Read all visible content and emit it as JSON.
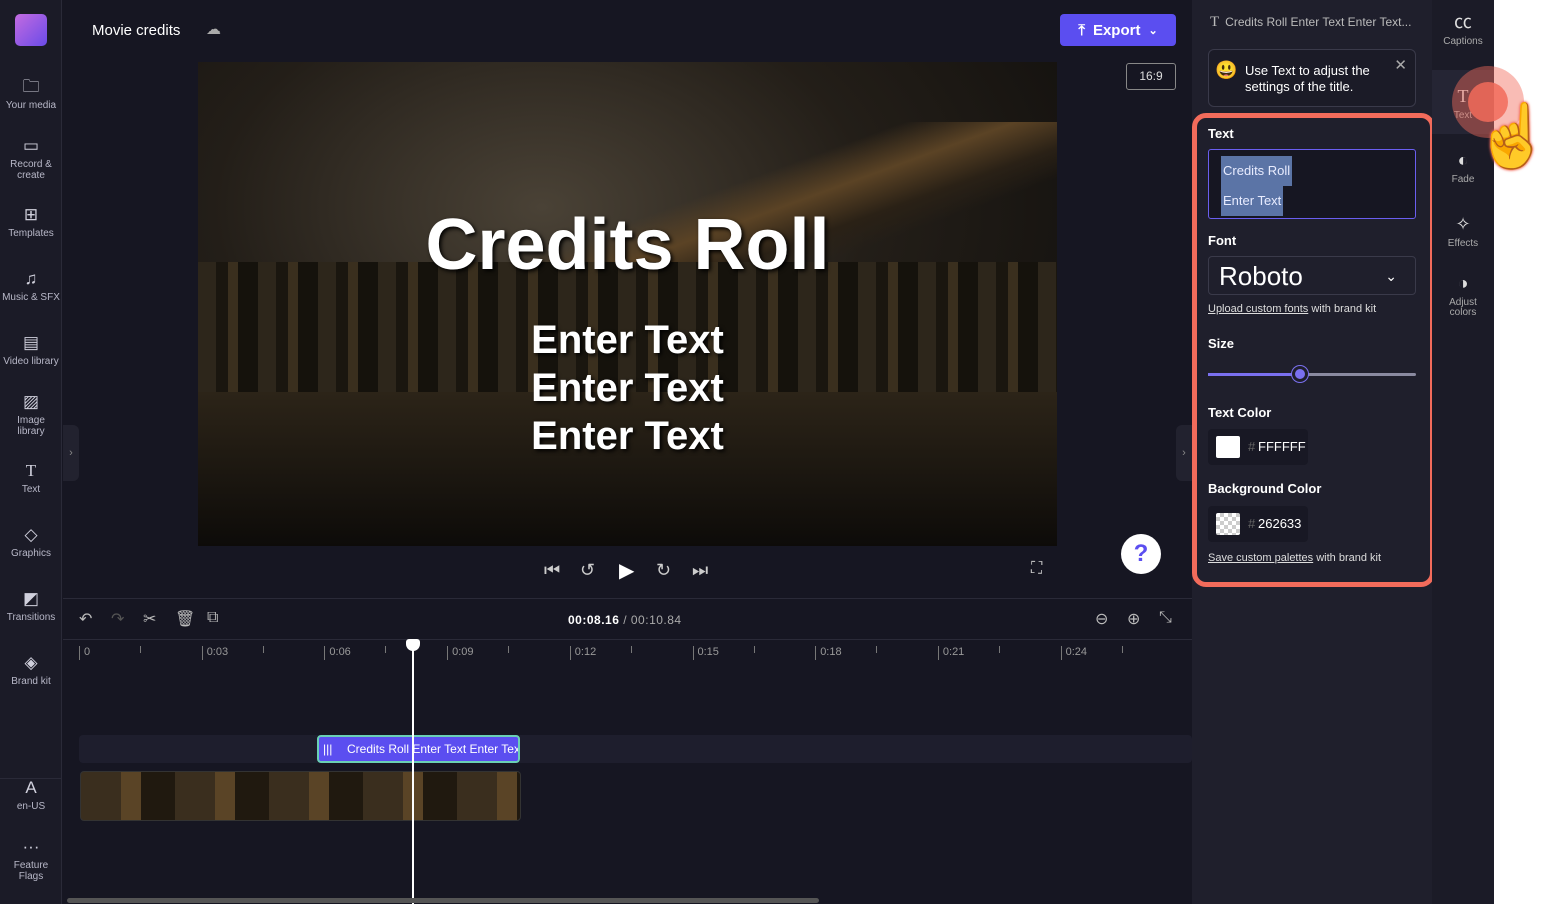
{
  "header": {
    "project_title": "Movie credits",
    "export_label": "Export",
    "aspect_ratio": "16:9"
  },
  "sidebar": {
    "items": [
      {
        "label": "Your media",
        "icon": "folder-icon"
      },
      {
        "label": "Record & create",
        "icon": "video-camera-icon"
      },
      {
        "label": "Templates",
        "icon": "templates-icon"
      },
      {
        "label": "Music & SFX",
        "icon": "music-icon"
      },
      {
        "label": "Video library",
        "icon": "film-icon"
      },
      {
        "label": "Image library",
        "icon": "image-icon"
      },
      {
        "label": "Text",
        "icon": "text-icon"
      },
      {
        "label": "Graphics",
        "icon": "shapes-icon"
      },
      {
        "label": "Transitions",
        "icon": "transitions-icon"
      },
      {
        "label": "Brand kit",
        "icon": "brand-icon"
      },
      {
        "label": "en-US",
        "icon": "language-icon"
      },
      {
        "label": "Feature Flags",
        "icon": "more-icon"
      }
    ]
  },
  "preview": {
    "title": "Credits Roll",
    "lines": [
      "Enter Text",
      "Enter Text",
      "Enter Text"
    ]
  },
  "timeline": {
    "current_time": "00:08.16",
    "total_time": "/ 00:10.84",
    "ticks": [
      "0",
      "0:03",
      "0:06",
      "0:09",
      "0:12",
      "0:15",
      "0:18",
      "0:21",
      "0:24"
    ],
    "text_clip_label": "Credits Roll Enter Text Enter Text"
  },
  "panel": {
    "header": "Credits Roll Enter Text Enter Text...",
    "tip": "Use Text to adjust the settings of the title.",
    "text_label": "Text",
    "text_lines": [
      "Credits Roll",
      "Enter Text"
    ],
    "font_label": "Font",
    "font_value": "Roboto",
    "upload_link": "Upload custom fonts",
    "upload_suffix": "with brand kit",
    "size_label": "Size",
    "size_fraction": 0.44,
    "text_color_label": "Text Color",
    "text_color": "FFFFFF",
    "bg_color_label": "Background Color",
    "bg_color": "262633",
    "palette_link": "Save custom palettes",
    "palette_suffix": "with brand kit"
  },
  "rail": {
    "items": [
      {
        "label": "Captions"
      },
      {
        "label": "Text"
      },
      {
        "label": "Fade"
      },
      {
        "label": "Effects"
      },
      {
        "label": "Adjust colors"
      }
    ]
  },
  "colors": {
    "accent": "#5b4ef0",
    "highlight": "#f26b5b",
    "clip_border": "#6ad0b5"
  }
}
